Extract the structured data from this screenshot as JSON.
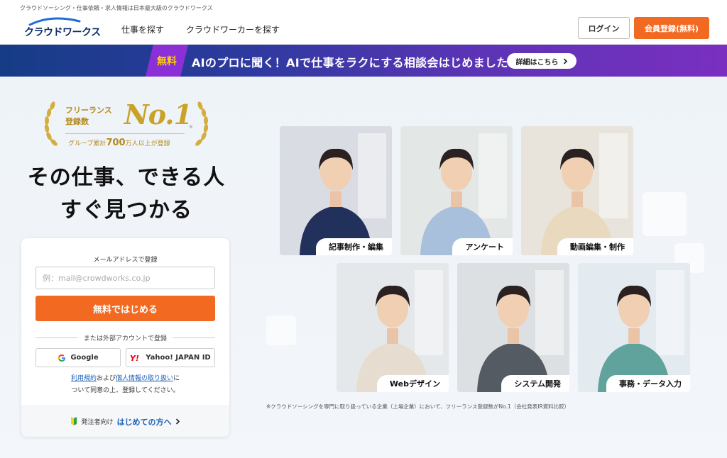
{
  "header": {
    "tagline": "クラウドソーシング・仕事依頼・求人情報は日本最大級のクラウドワークス",
    "logo_text": "クラウドワークス",
    "nav": [
      "仕事を探す",
      "クラウドワーカーを探す"
    ],
    "login_label": "ログイン",
    "register_label": "会員登録(無料)"
  },
  "banner": {
    "badge": "無料",
    "text": "AIのプロに聞く！AIで仕事をラクにする相談会はじめました",
    "button_label": "詳細はこちら"
  },
  "award": {
    "line1": "フリーランス",
    "line2": "登録数",
    "rank": "No.1",
    "note_mark": "※",
    "group_prefix": "グループ累計",
    "group_number": "700",
    "group_suffix": "万人以上が登録"
  },
  "headline": {
    "line1": "その仕事、できる人",
    "line2": "すぐ見つかる"
  },
  "signup": {
    "email_label": "メールアドレスで登録",
    "email_placeholder": "例：mail@crowdworks.co.jp",
    "email_value": "",
    "cta_label": "無料ではじめる",
    "or_label": "または外部アカウントで登録",
    "google_label": "Google",
    "yahoo_label": "Yahoo! JAPAN ID",
    "terms_link": "利用規約",
    "terms_and": "および",
    "privacy_link": "個人情報の取り扱い",
    "terms_suffix": "に",
    "terms_line2": "ついて同意の上、登録してください。",
    "client_prefix": "発注者向け",
    "client_link": "はじめての方へ"
  },
  "categories": [
    {
      "label": "記事制作・編集",
      "bg": "#d9dde3",
      "shirt": "#22305c"
    },
    {
      "label": "アンケート",
      "bg": "#e3e8e6",
      "shirt": "#a9c0dc"
    },
    {
      "label": "動画編集・制作",
      "bg": "#e8e4dc",
      "shirt": "#e8d9bf"
    },
    {
      "label": "Webデザイン",
      "bg": "#e5e8ea",
      "shirt": "#e6ddd0"
    },
    {
      "label": "システム開発",
      "bg": "#dde0e3",
      "shirt": "#555b63"
    },
    {
      "label": "事務・データ入力",
      "bg": "#e3eaf0",
      "shirt": "#5fa39c"
    }
  ],
  "footnote": "※クラウドソーシングを専門に取り扱っている企業（上場企業）において、フリーランス登録数がNo.1（会社発表IR資料比較）",
  "colors": {
    "accent_orange": "#f26a22",
    "brand_navy": "#0b2d6b",
    "gold": "#c9a227",
    "link_blue": "#1b5fb8"
  },
  "icons": [
    "logo-swoosh-icon",
    "chevron-right-icon",
    "google-g-icon",
    "yahoo-y-icon",
    "beginner-mark-icon",
    "laurel-left-icon",
    "laurel-right-icon"
  ]
}
